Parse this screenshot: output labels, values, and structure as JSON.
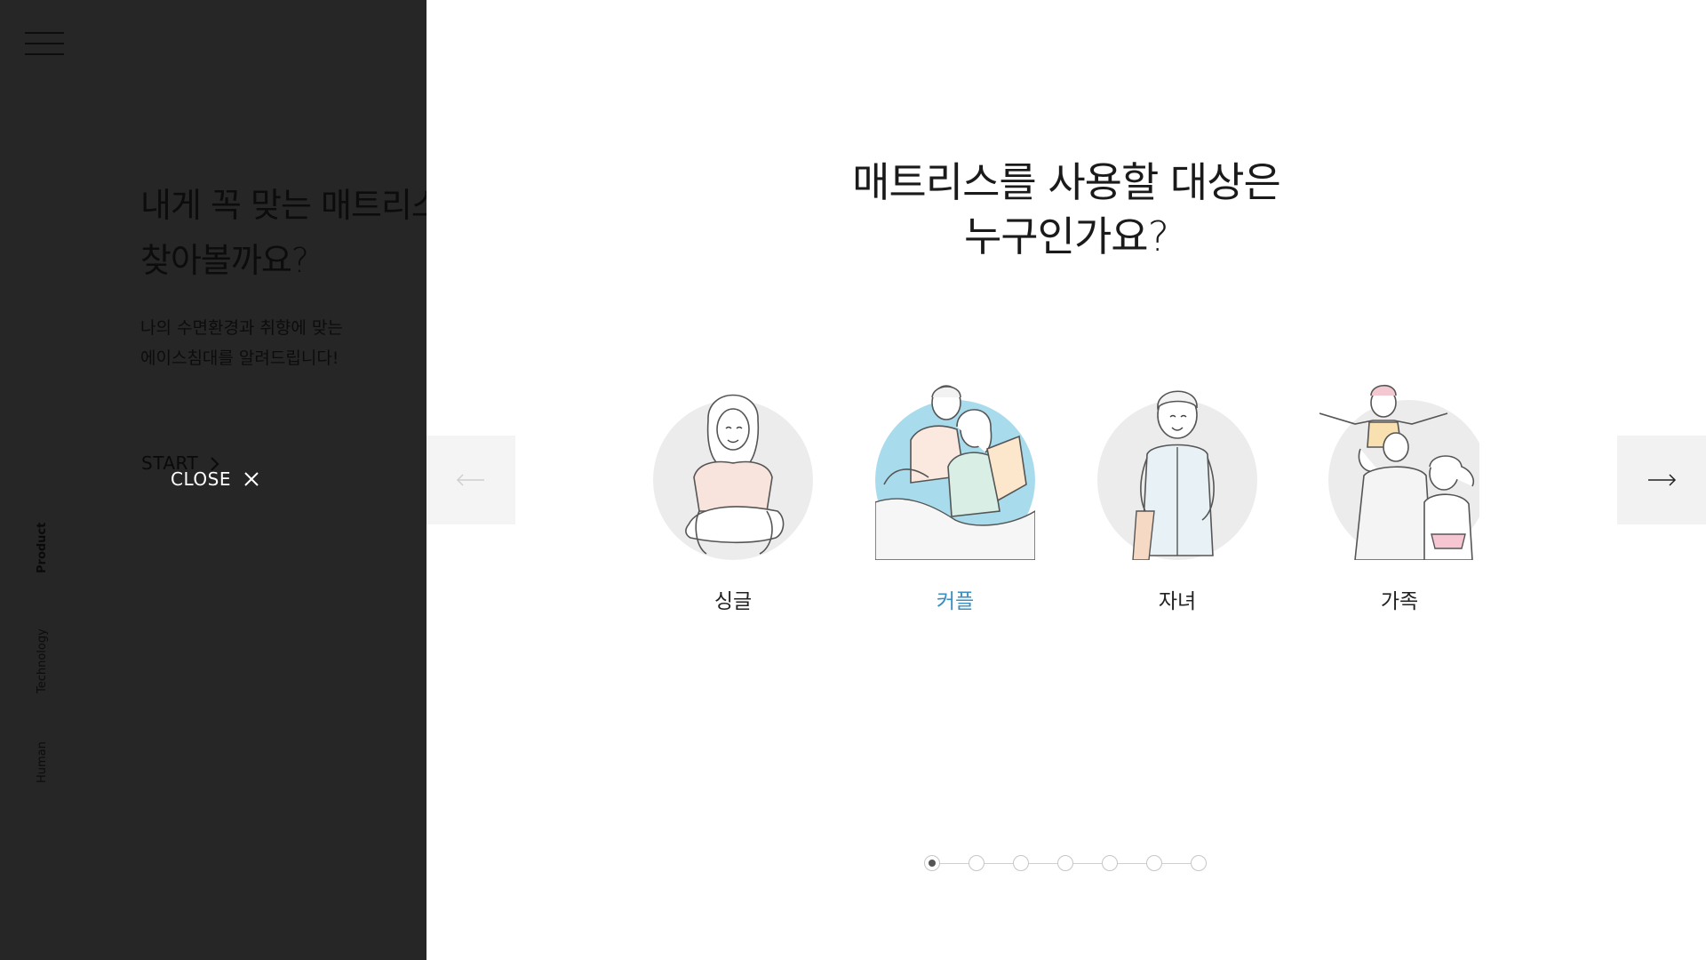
{
  "sidebar": {
    "intro_title": "내게 꼭 맞는 매트리스\n찾아볼까요?",
    "intro_desc": "나의 수면환경과 취향에 맞는\n에이스침대를 알려드립니다!",
    "start_label": "START",
    "close_label": "CLOSE",
    "nav": [
      "Product",
      "Technology",
      "Human"
    ]
  },
  "main": {
    "question": "매트리스를 사용할 대상은\n누구인가요?",
    "options": [
      {
        "label": "싱글",
        "icon": "single-person-illustration",
        "selected": false
      },
      {
        "label": "커플",
        "icon": "couple-illustration",
        "selected": true
      },
      {
        "label": "자녀",
        "icon": "child-illustration",
        "selected": false
      },
      {
        "label": "가족",
        "icon": "family-illustration",
        "selected": false
      }
    ],
    "pager": {
      "total": 7,
      "current": 1
    }
  },
  "colors": {
    "accent": "#3a8fc2",
    "panel_dark": "#262626",
    "circle_gray": "#ececec",
    "circle_blue": "#a8dcec"
  }
}
